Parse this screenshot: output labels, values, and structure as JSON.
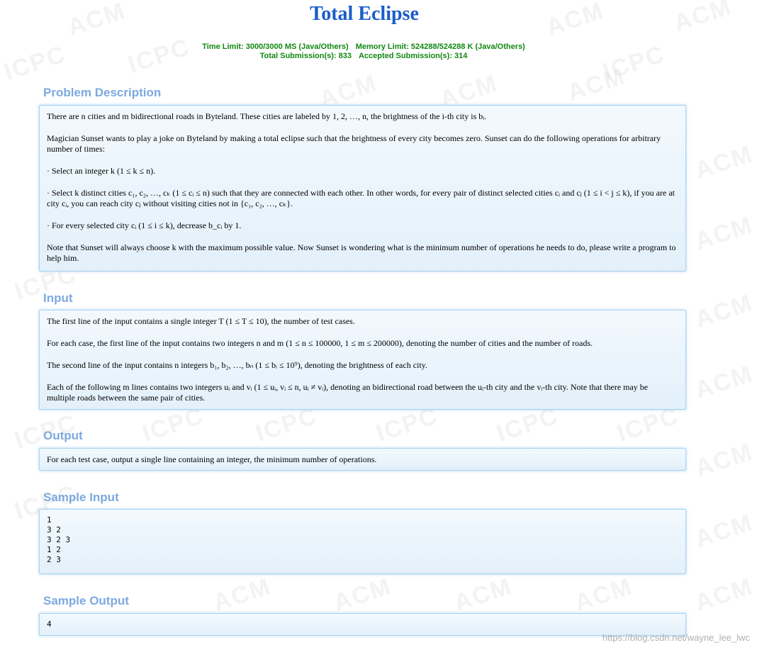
{
  "title": "Total Eclipse",
  "limits": {
    "time_limit": "Time Limit: 3000/3000 MS (Java/Others)",
    "memory_limit": "Memory Limit: 524288/524288 K (Java/Others)",
    "total_submissions": "Total Submission(s): 833",
    "accepted_submissions": "Accepted Submission(s): 314"
  },
  "sections": {
    "description": {
      "heading": "Problem Description",
      "paragraphs": [
        "There are n cities and m bidirectional roads in Byteland. These cities are labeled by 1, 2, …, n, the brightness of the i-th city is bᵢ.",
        "Magician Sunset wants to play a joke on Byteland by making a total eclipse such that the brightness of every city becomes zero. Sunset can do the following operations for arbitrary number of times:",
        "· Select an integer k (1 ≤ k ≤ n).",
        "· Select k distinct cities c₁, c₂, …, cₖ (1 ≤ cᵢ ≤ n) such that they are connected with each other. In other words, for every pair of distinct selected cities cᵢ and cⱼ (1 ≤ i < j ≤ k), if you are at city cᵢ, you can reach city cⱼ without visiting cities not in {c₁, c₂, …, cₖ}.",
        "· For every selected city cᵢ (1 ≤ i ≤ k), decrease b_cᵢ by 1.",
        "Note that Sunset will always choose k with the maximum possible value. Now Sunset is wondering what is the minimum number of operations he needs to do, please write a program to help him."
      ]
    },
    "input": {
      "heading": "Input",
      "paragraphs": [
        "The first line of the input contains a single integer T (1 ≤ T ≤ 10), the number of test cases.",
        "For each case, the first line of the input contains two integers n and m (1 ≤ n ≤ 100000, 1 ≤ m ≤ 200000), denoting the number of cities and the number of roads.",
        "The second line of the input contains n integers b₁, b₂, …, bₙ (1 ≤ bᵢ ≤ 10⁹), denoting the brightness of each city.",
        "Each of the following m lines contains two integers uᵢ and vᵢ (1 ≤ uᵢ, vᵢ ≤ n, uᵢ ≠ vᵢ), denoting an bidirectional road between the uᵢ-th city and the vᵢ-th city. Note that there may be multiple roads between the same pair of cities."
      ]
    },
    "output": {
      "heading": "Output",
      "paragraphs": [
        "For each test case, output a single line containing an integer, the minimum number of operations."
      ]
    },
    "sample_input": {
      "heading": "Sample Input",
      "text": "1\n3 2\n3 2 3\n1 2\n2 3"
    },
    "sample_output": {
      "heading": "Sample Output",
      "text": "4"
    }
  },
  "footer_url": "https://blog.csdn.net/wayne_lee_lwc",
  "colors": {
    "title": "#1a5cc8",
    "limits": "#118811",
    "section_heading": "#7ca9e0",
    "panel_border": "#a7d3f1"
  }
}
